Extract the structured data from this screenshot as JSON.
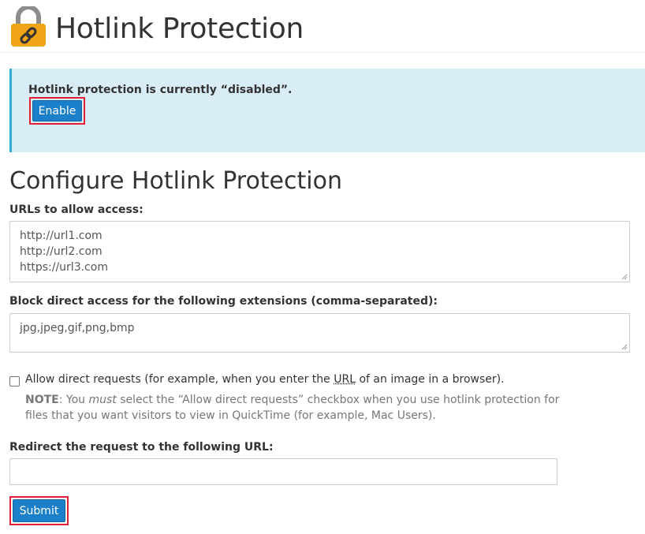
{
  "header": {
    "title": "Hotlink Protection",
    "icon": "lock-link-icon"
  },
  "alert": {
    "message": "Hotlink protection is currently “disabled”.",
    "button_label": "Enable"
  },
  "configure": {
    "title": "Configure Hotlink Protection",
    "urls_label": "URLs to allow access:",
    "urls": [
      "http://url1.com",
      "http://url2.com",
      "https://url3.com"
    ],
    "extensions_label": "Block direct access for the following extensions (comma-separated):",
    "extensions_value": "jpg,jpeg,gif,png,bmp",
    "allow_direct": {
      "checked": false,
      "label_before": "Allow direct requests (for example, when you enter the ",
      "label_abbr": "URL",
      "label_after": " of an image in a browser)."
    },
    "note": {
      "prefix": "NOTE",
      "part1": ": You ",
      "emphasis": "must",
      "part2": " select the “Allow direct requests” checkbox when you use hotlink protection for files that you want visitors to view in QuickTime (for example, Mac Users)."
    },
    "redirect_label": "Redirect the request to the following URL:",
    "redirect_value": "",
    "submit_label": "Submit"
  },
  "colors": {
    "accent": "#1b7fc9",
    "alert_bg": "#d9edf7",
    "alert_border": "#31a9d6",
    "highlight": "#e01e36",
    "lock_body": "#f2a417",
    "lock_shackle": "#8c8c8c"
  }
}
